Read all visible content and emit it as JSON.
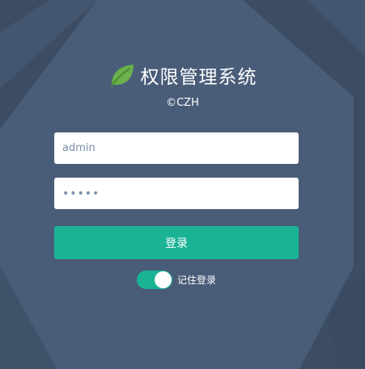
{
  "header": {
    "logo_icon": "leaf-icon",
    "title": "权限管理系统",
    "copyright": "©CZH"
  },
  "form": {
    "username_value": "admin",
    "password_value": "•••••",
    "login_label": "登录",
    "remember_label": "记住登录",
    "remember_checked": true
  },
  "colors": {
    "background": "#3c4c63",
    "hexagon": "#495c78",
    "accent": "#1ab394",
    "leaf": "#6ab04c"
  }
}
